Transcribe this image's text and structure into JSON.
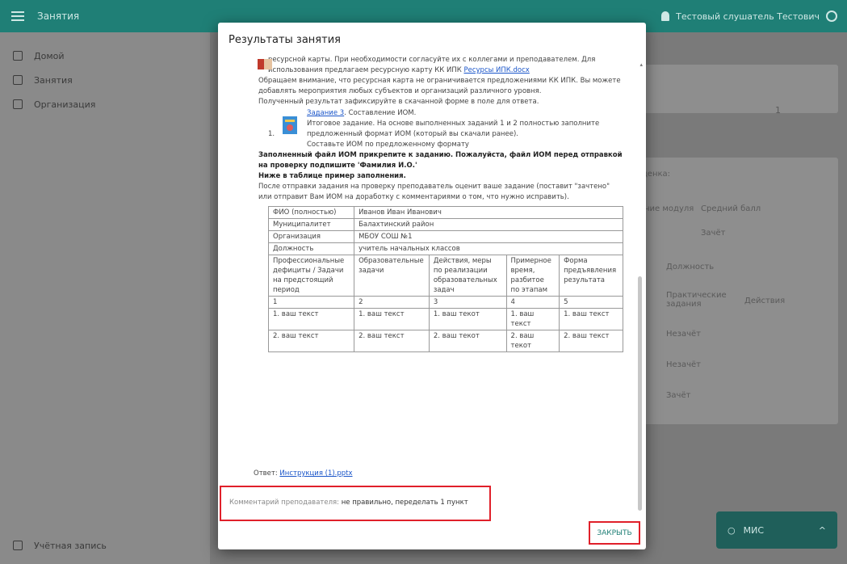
{
  "app": {
    "title": "Занятия",
    "user_name": "Тестовый слушатель Тестович"
  },
  "sidebar": {
    "items": [
      {
        "label": "Домой"
      },
      {
        "label": "Занятия"
      },
      {
        "label": "Организация"
      }
    ],
    "bottom_item": "Учётная запись"
  },
  "background": {
    "page_badge": "1",
    "rating_label": "ценка:",
    "col_module": "ние модуля",
    "col_avg": "Средний балл",
    "zachet_select": "Зачёт",
    "col_position": "Должность",
    "col_practical": "Практические задания",
    "col_actions": "Действия",
    "row1": "Незачёт",
    "row2": "Незачёт",
    "row3": "Зачёт"
  },
  "chat": {
    "label": "МИС"
  },
  "dialog": {
    "title": "Результаты занятия",
    "intro_line1": "ресурсной карты. При необходимости согласуйте их с коллегами и преподавателем. Для",
    "intro_line2_pre": "использования предлагаем ресурсную карту КК ИПК",
    "intro_link": "Ресурсы ИПК.docx",
    "p1": "Обращаем внимание, что ресурсная карта не ограничивается предложениями КК ИПК. Вы можете добавлять мероприятия любых субъектов и организаций различного уровня.",
    "p2": "Полученный результат зафиксируйте в скачанной форме в поле для ответа.",
    "task_num": "1.",
    "task_title_link": "Задание 3",
    "task_title_rest": ". Составление ИОМ.",
    "task_desc": "Итоговое задание. На основе выполненных заданий 1 и 2 полностью заполните предложенный формат ИОМ (который вы скачали ранее).",
    "task_desc2": "Составьте ИОМ по предложенному формату",
    "bold1": "Заполненный файл ИОМ прикрепите к заданию. Пожалуйста, файл ИОМ перед отправкой на проверку подпишите 'Фамилия И.О.'",
    "bold2": "Ниже в таблице пример заполнения.",
    "p3": "После отправки задания на проверку преподаватель оценит ваше задание (поставит \"зачтено\" или отправит Вам ИОМ на доработку с комментариями о том, что нужно исправить).",
    "table": {
      "info": [
        {
          "k": "ФИО (полностью)",
          "v": "Иванов Иван Иванович"
        },
        {
          "k": "Муниципалитет",
          "v": "Балахтинский район"
        },
        {
          "k": "Организация",
          "v": "МБОУ СОШ №1"
        },
        {
          "k": "Должность",
          "v": "учитель начальных классов"
        }
      ],
      "headers": [
        "Профессиональные дефициты / Задачи на предстоящий период",
        "Образовательные задачи",
        "Действия, меры по реализации образовательных задач",
        "Примерное время, разбитое по этапам",
        "Форма предъявления результата"
      ],
      "nums": [
        "1",
        "2",
        "3",
        "4",
        "5"
      ],
      "row1": [
        "1. ваш текст",
        "1. ваш текст",
        "1. ваш текот",
        "1. ваш текст",
        "1. ваш текст"
      ],
      "row2": [
        "2. ваш текст",
        "2. ваш текст",
        "2. ваш текот",
        "2. ваш текот",
        "2. ваш текст"
      ]
    },
    "answer_label": "Ответ:",
    "answer_link": "Инструкция (1).pptx",
    "comment_label": "Комментарий преподавателя:",
    "comment_value": "не правильно, переделать 1 пункт",
    "close_label": "ЗАКРЫТЬ"
  }
}
